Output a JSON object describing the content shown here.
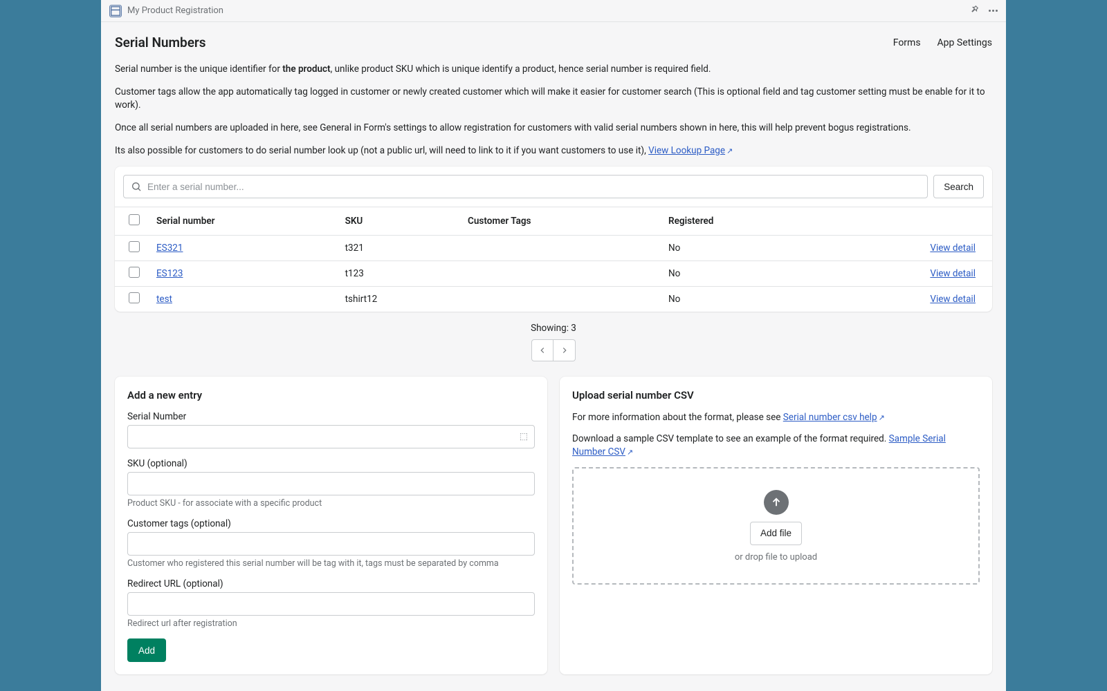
{
  "titlebar": {
    "app_name": "My Product Registration"
  },
  "header": {
    "title": "Serial Numbers",
    "nav": {
      "forms": "Forms",
      "settings": "App Settings"
    }
  },
  "intro": {
    "p1_a": "Serial number is the unique identifier for ",
    "p1_b": "the product",
    "p1_c": ", unlike product SKU which is unique identify a product, hence serial number is required field.",
    "p2": "Customer tags allow the app automatically tag logged in customer or newly created customer which will make it easier for customer search (This is optional field and tag customer setting must be enable for it to work).",
    "p3": "Once all serial numbers are uploaded in here, see General in Form's settings to allow registration for customers with valid serial numbers shown in here, this will help prevent bogus registrations.",
    "p4_a": "Its also possible for customers to do serial number look up (not a public url, will need to link to it if you want customers to use it), ",
    "p4_link": "View Lookup Page"
  },
  "search": {
    "placeholder": "Enter a serial number...",
    "button": "Search"
  },
  "table": {
    "headers": {
      "serial": "Serial number",
      "sku": "SKU",
      "tags": "Customer Tags",
      "registered": "Registered"
    },
    "rows": [
      {
        "serial": "ES321",
        "sku": "t321",
        "tags": "",
        "registered": "No",
        "action": "View detail"
      },
      {
        "serial": "ES123",
        "sku": "t123",
        "tags": "",
        "registered": "No",
        "action": "View detail"
      },
      {
        "serial": "test",
        "sku": "tshirt12",
        "tags": "",
        "registered": "No",
        "action": "View detail"
      }
    ]
  },
  "pagination": {
    "showing": "Showing: 3"
  },
  "add_entry": {
    "title": "Add a new entry",
    "serial_label": "Serial Number",
    "sku_label": "SKU (optional)",
    "sku_hint": "Product SKU - for associate with a specific product",
    "tags_label": "Customer tags (optional)",
    "tags_hint": "Customer who registered this serial number will be tag with it, tags must be separated by comma",
    "redirect_label": "Redirect URL (optional)",
    "redirect_hint": "Redirect url after registration",
    "add_button": "Add"
  },
  "upload": {
    "title": "Upload serial number CSV",
    "p1_a": "For more information about the format, please see ",
    "p1_link": "Serial number csv help",
    "p2_a": "Download a sample CSV template to see an example of the format required. ",
    "p2_link": "Sample Serial Number CSV",
    "add_file": "Add file",
    "drop_hint": "or drop file to upload"
  }
}
